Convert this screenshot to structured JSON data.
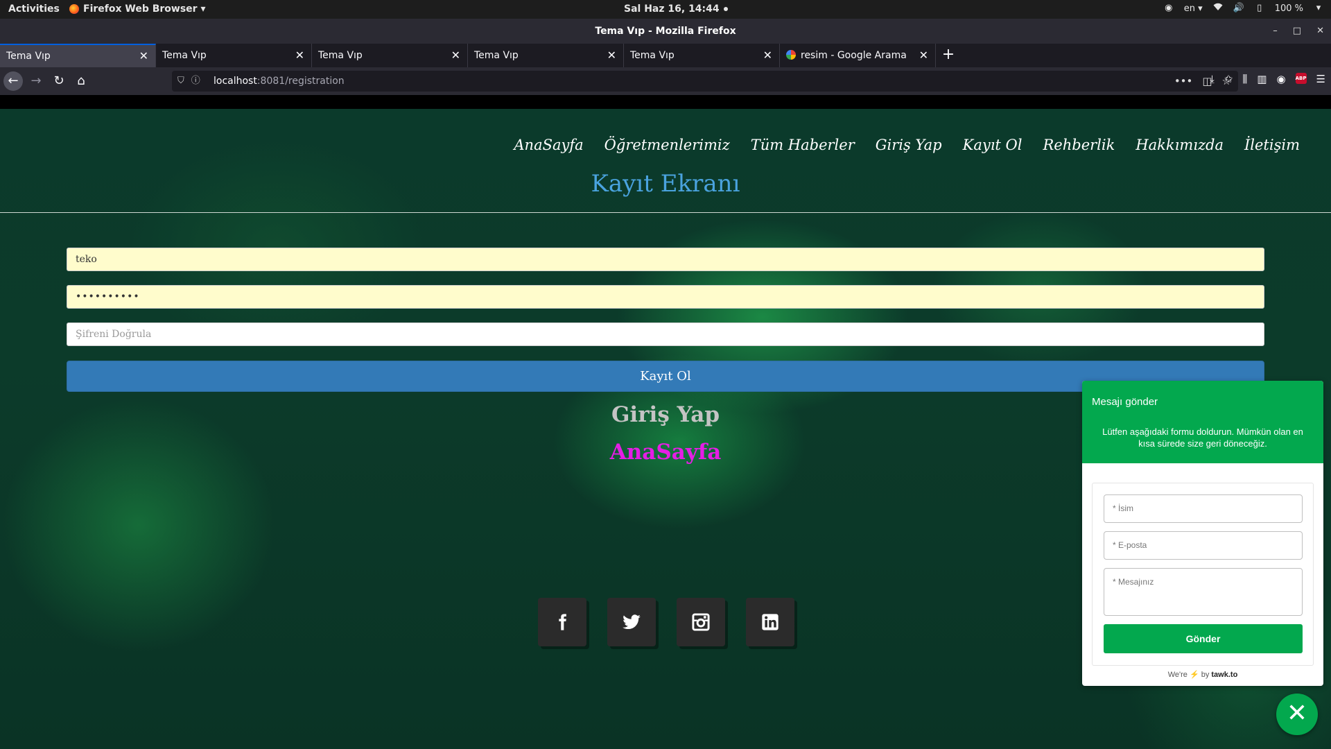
{
  "system": {
    "activities": "Activities",
    "app_menu": "Firefox Web Browser ▾",
    "clock": "Sal Haz 16, 14:44",
    "lang": "en ▾",
    "battery": "100 %"
  },
  "window": {
    "title": "Tema Vıp - Mozilla Firefox"
  },
  "tabs": [
    {
      "label": "Tema Vıp",
      "active": true
    },
    {
      "label": "Tema Vıp",
      "active": false
    },
    {
      "label": "Tema Vıp",
      "active": false
    },
    {
      "label": "Tema Vıp",
      "active": false
    },
    {
      "label": "Tema Vıp",
      "active": false
    },
    {
      "label": "resim - Google Arama",
      "active": false
    }
  ],
  "urlbar": {
    "host": "localhost",
    "path": ":8081/registration"
  },
  "site": {
    "nav": [
      "AnaSayfa",
      "Öğretmenlerimiz",
      "Tüm Haberler",
      "Giriş Yap",
      "Kayıt Ol",
      "Rehberlik",
      "Hakkımızda",
      "İletişim"
    ],
    "title": "Kayıt Ekranı",
    "form": {
      "username_value": "teko",
      "password_value": "••••••••••",
      "confirm_placeholder": "Şifreni Doğrula",
      "submit_label": "Kayıt Ol"
    },
    "login_link": "Giriş Yap",
    "home_link": "AnaSayfa",
    "social": [
      "facebook-icon",
      "twitter-icon",
      "instagram-icon",
      "linkedin-icon"
    ]
  },
  "chat": {
    "title": "Mesajı gönder",
    "description": "Lütfen aşağıdaki formu doldurun. Mümkün olan en kısa sürede size geri döneceğiz.",
    "name_placeholder": "* İsim",
    "email_placeholder": "* E-posta",
    "message_placeholder": "* Mesajınız",
    "send_label": "Gönder",
    "footer_pre": "We're",
    "footer_by": "by",
    "footer_brand": "tawk.to",
    "accent": "#03a84e"
  }
}
